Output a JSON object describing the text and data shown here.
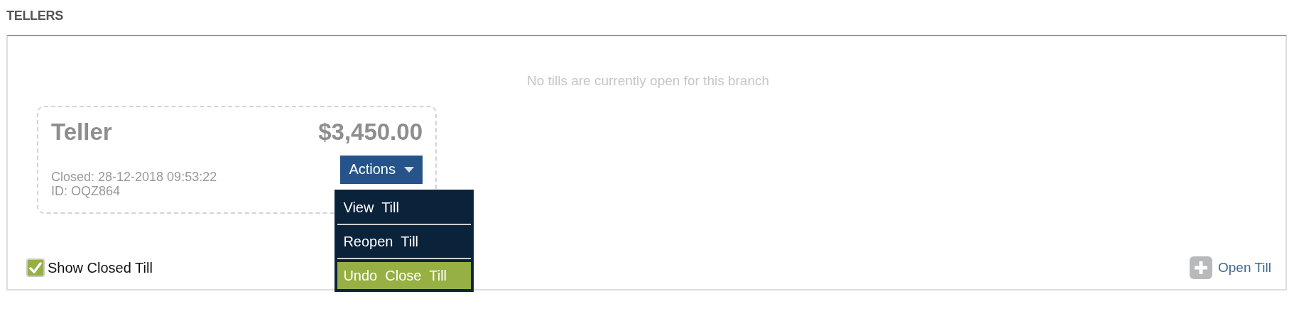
{
  "section_title": "TELLERS",
  "empty_message": "No tills are currently open for this branch",
  "tills": [
    {
      "name": "Teller",
      "amount": "$3,450.00",
      "closed": "Closed: 28-12-2018 09:53:22",
      "id": "ID: OQZ864",
      "actions_label": "Actions",
      "menu_open": true,
      "menu": [
        {
          "label": "View  Till",
          "selected": false
        },
        {
          "label": "Reopen  Till",
          "selected": false
        },
        {
          "label": "Undo  Close  Till",
          "selected": true
        }
      ]
    }
  ],
  "show_closed": {
    "label": "Show Closed Till",
    "checked": true
  },
  "open_till": {
    "label": "Open Till"
  }
}
